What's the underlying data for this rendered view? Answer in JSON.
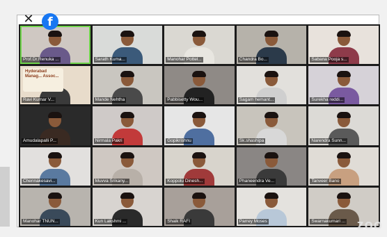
{
  "window": {
    "close_glyph": "✕",
    "share_icon": "facebook-icon",
    "share_glyph": "f",
    "watermark": "zoo"
  },
  "colors": {
    "active_speaker": "#6fd44a",
    "facebook": "#1877f2"
  },
  "participants": [
    {
      "name": "Prof.Dr.Renuka ...",
      "bg": "#cfc8c2",
      "shirt": "#6a5a8a",
      "active": true
    },
    {
      "name": "Sarath Kuma...",
      "bg": "#d9dbd9",
      "shirt": "#3b5a7a"
    },
    {
      "name": "Manohar Pottel...",
      "bg": "#dad8d2",
      "shirt": "#e8e6e0"
    },
    {
      "name": "Chandra Bo...",
      "bg": "#b6b2aa",
      "shirt": "#2b3a4a"
    },
    {
      "name": "Sabana Pooja s...",
      "bg": "#e8e2dc",
      "shirt": "#8e3b4a"
    },
    {
      "name": "Ravi Kumar V...",
      "bg": "#e8dccb",
      "shirt": "#3a3a3a",
      "banner": "Hyderabad Manag... Assoc..."
    },
    {
      "name": "Mande Nehtha",
      "bg": "#c9c6c0",
      "shirt": "#4a4a4a"
    },
    {
      "name": "Pabbisetty Wou...",
      "bg": "#8f8a86",
      "shirt": "#222222"
    },
    {
      "name": "Sagam hemant...",
      "bg": "#e2e0dc",
      "shirt": "#cfcfcf"
    },
    {
      "name": "Surekha reddi...",
      "bg": "#d6d2d8",
      "shirt": "#7a5aa0"
    },
    {
      "name": "Amudalapalli P...",
      "bg": "#2a2a2a",
      "shirt": "#3a2a22"
    },
    {
      "name": "Nirmala Pakri",
      "bg": "#cfcac8",
      "shirt": "#c23a3a"
    },
    {
      "name": "Gopikrishnu",
      "bg": "#e6e6e6",
      "shirt": "#4f6fa0"
    },
    {
      "name": "Sk.shashipa",
      "bg": "#c8c4bc",
      "shirt": "#d8d8d8"
    },
    {
      "name": "Narendra Sunn...",
      "bg": "#dcdad6",
      "shirt": "#5a5a5a"
    },
    {
      "name": "Chennakesavi...",
      "bg": "#e2e0de",
      "shirt": "#5a7aa0"
    },
    {
      "name": "Muvva Srikany...",
      "bg": "#cfc8c2",
      "shirt": "#b8b0a8"
    },
    {
      "name": "Koppolu Dinesh...",
      "bg": "#d8d4cc",
      "shirt": "#a03a3a"
    },
    {
      "name": "Phaneendra Ve...",
      "bg": "#8a8684",
      "shirt": "#3a3a3a"
    },
    {
      "name": "Tanveer Bano",
      "bg": "#e0dcd6",
      "shirt": "#c8a080"
    },
    {
      "name": "Manohar TNUN...",
      "bg": "#b8b4ae",
      "shirt": "#3a4a5a"
    },
    {
      "name": "Kun Lakshmi ...",
      "bg": "#d8d4d0",
      "shirt": "#2a2a2a"
    },
    {
      "name": "Shaik RAFI",
      "bg": "#a8a09a",
      "shirt": "#3a3a3a"
    },
    {
      "name": "Parrey Moses",
      "bg": "#e4e2de",
      "shirt": "#b8c8d8"
    },
    {
      "name": "Swarnakumari ...",
      "bg": "#d0ccc6",
      "shirt": "#6a5a4a"
    }
  ]
}
